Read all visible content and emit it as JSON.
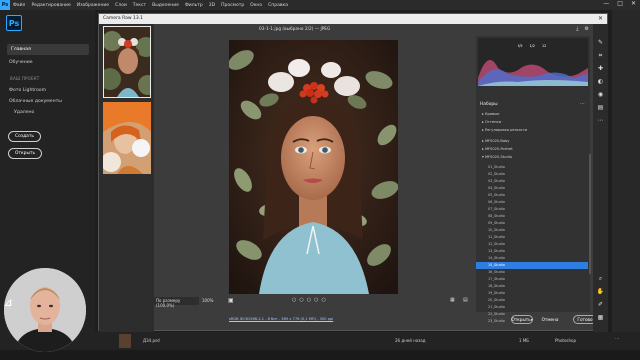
{
  "menubar": {
    "app_short": "Ps",
    "items": [
      "Файл",
      "Редактирование",
      "Изображение",
      "Слои",
      "Текст",
      "Выделение",
      "Фильтр",
      "3D",
      "Просмотр",
      "Окно",
      "Справка"
    ],
    "controls": [
      "—",
      "□",
      "✕"
    ]
  },
  "sidebar": {
    "logo": "Ps",
    "home": "Главная",
    "learn": "Обучение",
    "section": "ВАШ ПРОЕКТ",
    "photos": "Фото Lightroom",
    "cloud_docs": "Облачные документы",
    "deleted": "Удалено",
    "create_btn": "Создать",
    "open_btn": "Открыть"
  },
  "dialog": {
    "title": "Camera Raw 13.1",
    "file_title": "03-1-1.jpg (выбрано 2/2) — JPEG",
    "zoom_label": "По размеру (100,0%)",
    "zoom_value": "100%",
    "info_link": "sRGB IEC61966-2.1 - 8 бит - 369 x 776 (0,1 МП) - 300 ppi",
    "open_btn": "Открыть",
    "cancel_btn": "Отмена",
    "done_btn": "Готово"
  },
  "histogram": {
    "values": [
      "f/5",
      "1/2",
      "12"
    ]
  },
  "panel": {
    "title": "Наборы",
    "tree": [
      "▸ Кривые",
      "▸ Оттенки",
      "▸ Регулировка резкости",
      "▸ MFS020-Baby",
      "▸ MFS020-Portret",
      "▾ MFS020-Studio"
    ],
    "presets": [
      "01_Studio",
      "02_Studio",
      "03_Studio",
      "04_Studio",
      "05_Studio",
      "06_Studio",
      "07_Studio",
      "08_Studio",
      "09_Studio",
      "10_Studio",
      "11_Studio",
      "12_Studio",
      "13_Studio",
      "14_Studio",
      "15_Studio",
      "16_Studio",
      "17_Studio",
      "18_Studio",
      "19_Studio",
      "20_Studio",
      "21_Studio",
      "22_Studio",
      "23_Studio"
    ],
    "selected_index": 14
  },
  "taskbar": {
    "file": "Д34.psd",
    "time": "26 дней назад",
    "size": "1 МБ",
    "app": "Photoshop"
  },
  "colors": {
    "accent": "#2f7de1",
    "ps_blue": "#31a8ff"
  }
}
